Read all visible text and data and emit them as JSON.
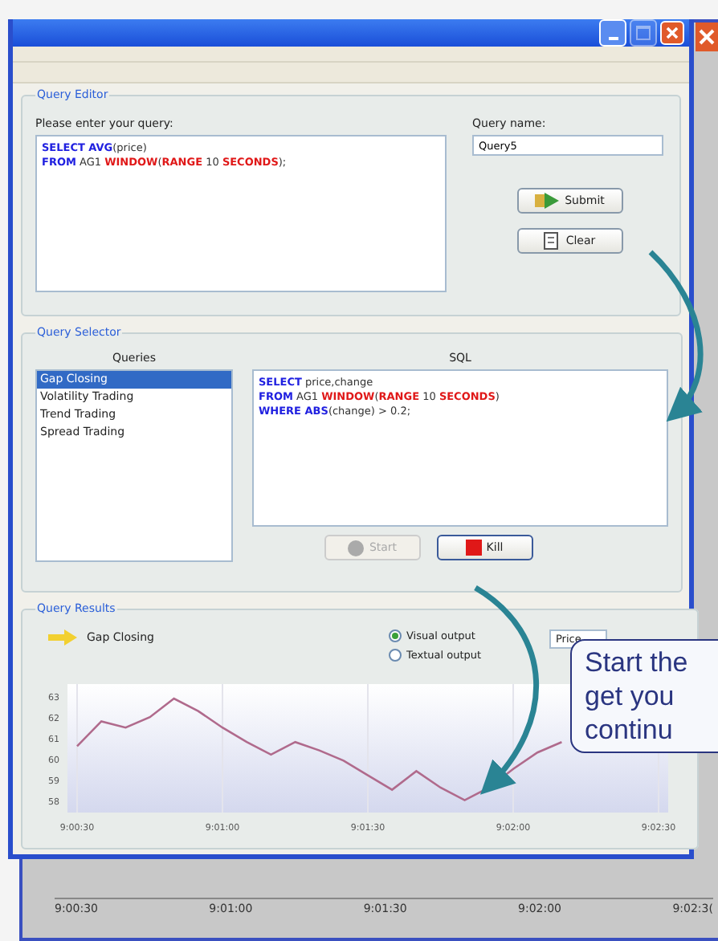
{
  "query_editor": {
    "title": "Query Editor",
    "prompt_label": "Please enter your query:",
    "query_lines": [
      [
        {
          "kind": "keyword",
          "text": "SELECT AVG"
        },
        {
          "kind": "plain",
          "text": "(price)"
        }
      ],
      [
        {
          "kind": "keyword",
          "text": "FROM"
        },
        {
          "kind": "plain",
          "text": " AG1 "
        },
        {
          "kind": "function",
          "text": "WINDOW"
        },
        {
          "kind": "plain",
          "text": "("
        },
        {
          "kind": "function",
          "text": "RANGE"
        },
        {
          "kind": "plain",
          "text": " 10 "
        },
        {
          "kind": "function",
          "text": "SECONDS"
        },
        {
          "kind": "plain",
          "text": ");"
        }
      ]
    ],
    "name_label": "Query name:",
    "name_value": "Query5",
    "buttons": [
      {
        "label": "Submit",
        "kind": "submit",
        "disabled": false
      },
      {
        "label": "Clear",
        "kind": "clear",
        "disabled": false
      }
    ]
  },
  "query_selector": {
    "title": "Query Selector",
    "queries_header": "Queries",
    "sql_header": "SQL",
    "queries": [
      {
        "label": "Gap Closing",
        "selected": true
      },
      {
        "label": "Volatility Trading",
        "selected": false
      },
      {
        "label": "Trend Trading",
        "selected": false
      },
      {
        "label": "Spread Trading",
        "selected": false
      }
    ],
    "sql_lines": [
      [
        {
          "kind": "keyword",
          "text": "SELECT"
        },
        {
          "kind": "plain",
          "text": " price,change"
        }
      ],
      [
        {
          "kind": "keyword",
          "text": "FROM"
        },
        {
          "kind": "plain",
          "text": " AG1 "
        },
        {
          "kind": "function",
          "text": "WINDOW"
        },
        {
          "kind": "plain",
          "text": "("
        },
        {
          "kind": "function",
          "text": "RANGE"
        },
        {
          "kind": "plain",
          "text": " 10 "
        },
        {
          "kind": "function",
          "text": "SECONDS"
        },
        {
          "kind": "plain",
          "text": ")"
        }
      ],
      [
        {
          "kind": "keyword",
          "text": "WHERE ABS"
        },
        {
          "kind": "plain",
          "text": "(change) > 0.2;"
        }
      ]
    ],
    "buttons": [
      {
        "label": "Start",
        "kind": "start",
        "disabled": true
      },
      {
        "label": "Kill",
        "kind": "kill",
        "disabled": false
      }
    ]
  },
  "query_results": {
    "title": "Query Results",
    "query_name": "Gap Closing",
    "outputs": [
      {
        "label": "Visual output",
        "selected": true
      },
      {
        "label": "Textual output",
        "selected": false
      }
    ],
    "field_dropdown": "Price",
    "chart_data": {
      "type": "line",
      "categories": [
        "9:00:30",
        null,
        null,
        null,
        null,
        null,
        "9:01:00",
        null,
        null,
        null,
        null,
        null,
        "9:01:30",
        null,
        null,
        null,
        null,
        null,
        "9:02:00",
        null,
        null,
        null,
        null,
        null,
        "9:02:30"
      ],
      "series": [
        {
          "color": "#b06a8c",
          "values": [
            60.6,
            61.8,
            61.5,
            62.0,
            62.9,
            62.3,
            61.5,
            60.8,
            60.2,
            60.8,
            60.4,
            59.9,
            59.2,
            58.5,
            59.4,
            58.6,
            58.0,
            58.6,
            59.5,
            60.3,
            60.8,
            null,
            null,
            null,
            null
          ]
        }
      ],
      "ylim": [
        57.4,
        63.6
      ],
      "grid": true,
      "yticks": [
        {
          "value": 63,
          "label": "63"
        },
        {
          "value": 62,
          "label": "62"
        },
        {
          "value": 61,
          "label": "61"
        },
        {
          "value": 60,
          "label": "60"
        },
        {
          "value": 59,
          "label": "59"
        },
        {
          "value": 58,
          "label": "58"
        }
      ]
    }
  },
  "background_window": {
    "axis_labels": [
      "9:00:30",
      "9:01:00",
      "9:01:30",
      "9:02:00",
      "9:02:3("
    ]
  },
  "callout": {
    "lines": [
      "Start the",
      "get you",
      "continu"
    ]
  }
}
